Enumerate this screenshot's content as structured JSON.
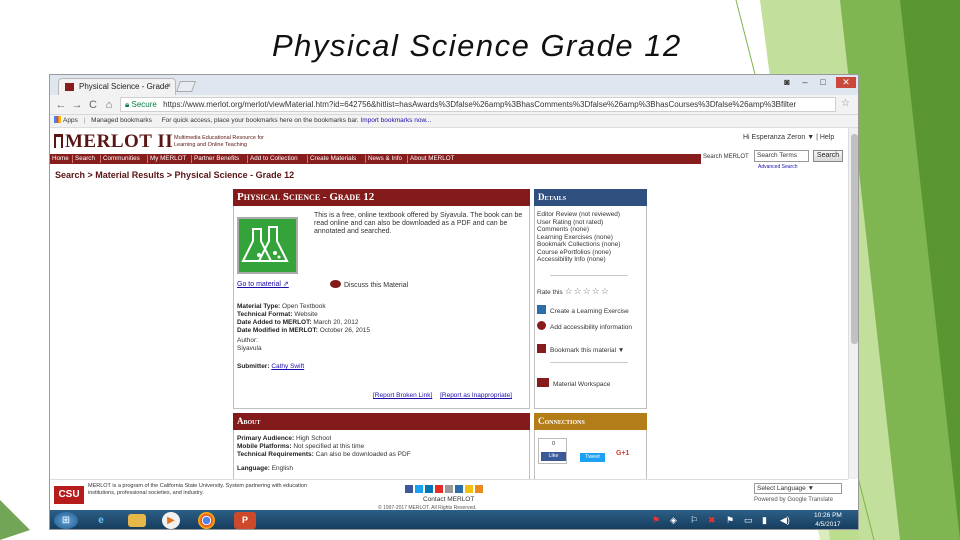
{
  "slide": {
    "title": "Physical Science Grade 12"
  },
  "browser": {
    "tab_title": "Physical Science - Grade",
    "tab_close": "×",
    "back": "←",
    "forward": "→",
    "reload": "C",
    "home": "⌂",
    "secure_label": "Secure",
    "url": "https://www.merlot.org/merlot/viewMaterial.htm?id=642756&hitlist=hasAwards%3Dfalse%26amp%3BhasComments%3Dfalse%26amp%3BhasCourses%3Dfalse%26amp%3Bfilter",
    "bookmarks": {
      "apps": "Apps",
      "managed": "Managed bookmarks",
      "hint": "For quick access, place your bookmarks here on the bookmarks bar.",
      "import_link": "Import bookmarks now..."
    }
  },
  "merlot": {
    "logo": "MERLOT II",
    "tagline": "Multimedia Educational Resource for Learning and Online Teaching",
    "user_links": "Hi Esperanza Zeron ▼ | Help",
    "nav": [
      "Home",
      "Search",
      "Communities",
      "My MERLOT",
      "Partner Benefits",
      "Add to Collection",
      "Create Materials",
      "News & Info",
      "About MERLOT"
    ],
    "search": {
      "label": "Search MERLOT",
      "value": "Search Terms",
      "button": "Search",
      "advanced": "Advanced Search"
    },
    "breadcrumb": "Search > Material Results > Physical Science - Grade 12"
  },
  "material": {
    "title": "Physical Science - Grade 12",
    "description": "This is a free, online textbook offered by Siyavula. The book can be read online and can also be downloaded as a PDF and can be annotated and searched.",
    "go_to_material": "Go to material",
    "discuss": "Discuss this Material",
    "meta": [
      {
        "label": "Material Type:",
        "value": "Open Textbook"
      },
      {
        "label": "Technical Format:",
        "value": "Website"
      },
      {
        "label": "Date Added to MERLOT:",
        "value": "March 20, 2012"
      },
      {
        "label": "Date Modified in MERLOT:",
        "value": "October 26, 2015"
      },
      {
        "label": "Author:",
        "value": ""
      }
    ],
    "author_name": "Siyavula",
    "submitter_label": "Submitter:",
    "submitter_name": "Cathy Swift",
    "report_broken": "[Report Broken Link]",
    "report_inappropriate": "[Report as Inappropriate]"
  },
  "details": {
    "title": "Details",
    "lines": [
      "Editor Review (not reviewed)",
      "User Rating (not rated)",
      "Comments (none)",
      "Learning Exercises (none)",
      "Bookmark Collections (none)",
      "Course ePortfolios (none)",
      "Accessibility Info (none)"
    ],
    "rate_label": "Rate this",
    "rating_stars": "☆☆☆☆☆",
    "actions": [
      "Create a Learning Exercise",
      "Add accessibility information",
      "Bookmark this material ▼",
      "Material Workspace"
    ]
  },
  "about": {
    "title": "About",
    "lines": [
      {
        "label": "Primary Audience:",
        "value": "High School"
      },
      {
        "label": "Mobile Platforms:",
        "value": "Not specified at this time"
      },
      {
        "label": "Technical Requirements:",
        "value": "Can also be downloaded as PDF"
      },
      {
        "label": "Language:",
        "value": "English"
      }
    ]
  },
  "connections": {
    "title": "Connections",
    "fb_count": "0",
    "like": "Like",
    "tweet": "Tweet",
    "gplus": "G+1"
  },
  "footer": {
    "csu": "CSU",
    "text": "MERLOT is a program of the California State University. System partnering with education institutions, professional societies, and industry.",
    "contact": "Contact MERLOT",
    "copyright": "© 1997-2017 MERLOT. All Rights Reserved.",
    "language": "Select Language ▼",
    "powered": "Powered by Google Translate"
  },
  "taskbar": {
    "time": "10:26 PM",
    "date": "4/5/2017"
  },
  "colors": {
    "merlot_red": "#861c1c",
    "details_blue": "#2f4f7f",
    "connections_gold": "#b37d19",
    "slide_green": "#7bbf3a"
  }
}
